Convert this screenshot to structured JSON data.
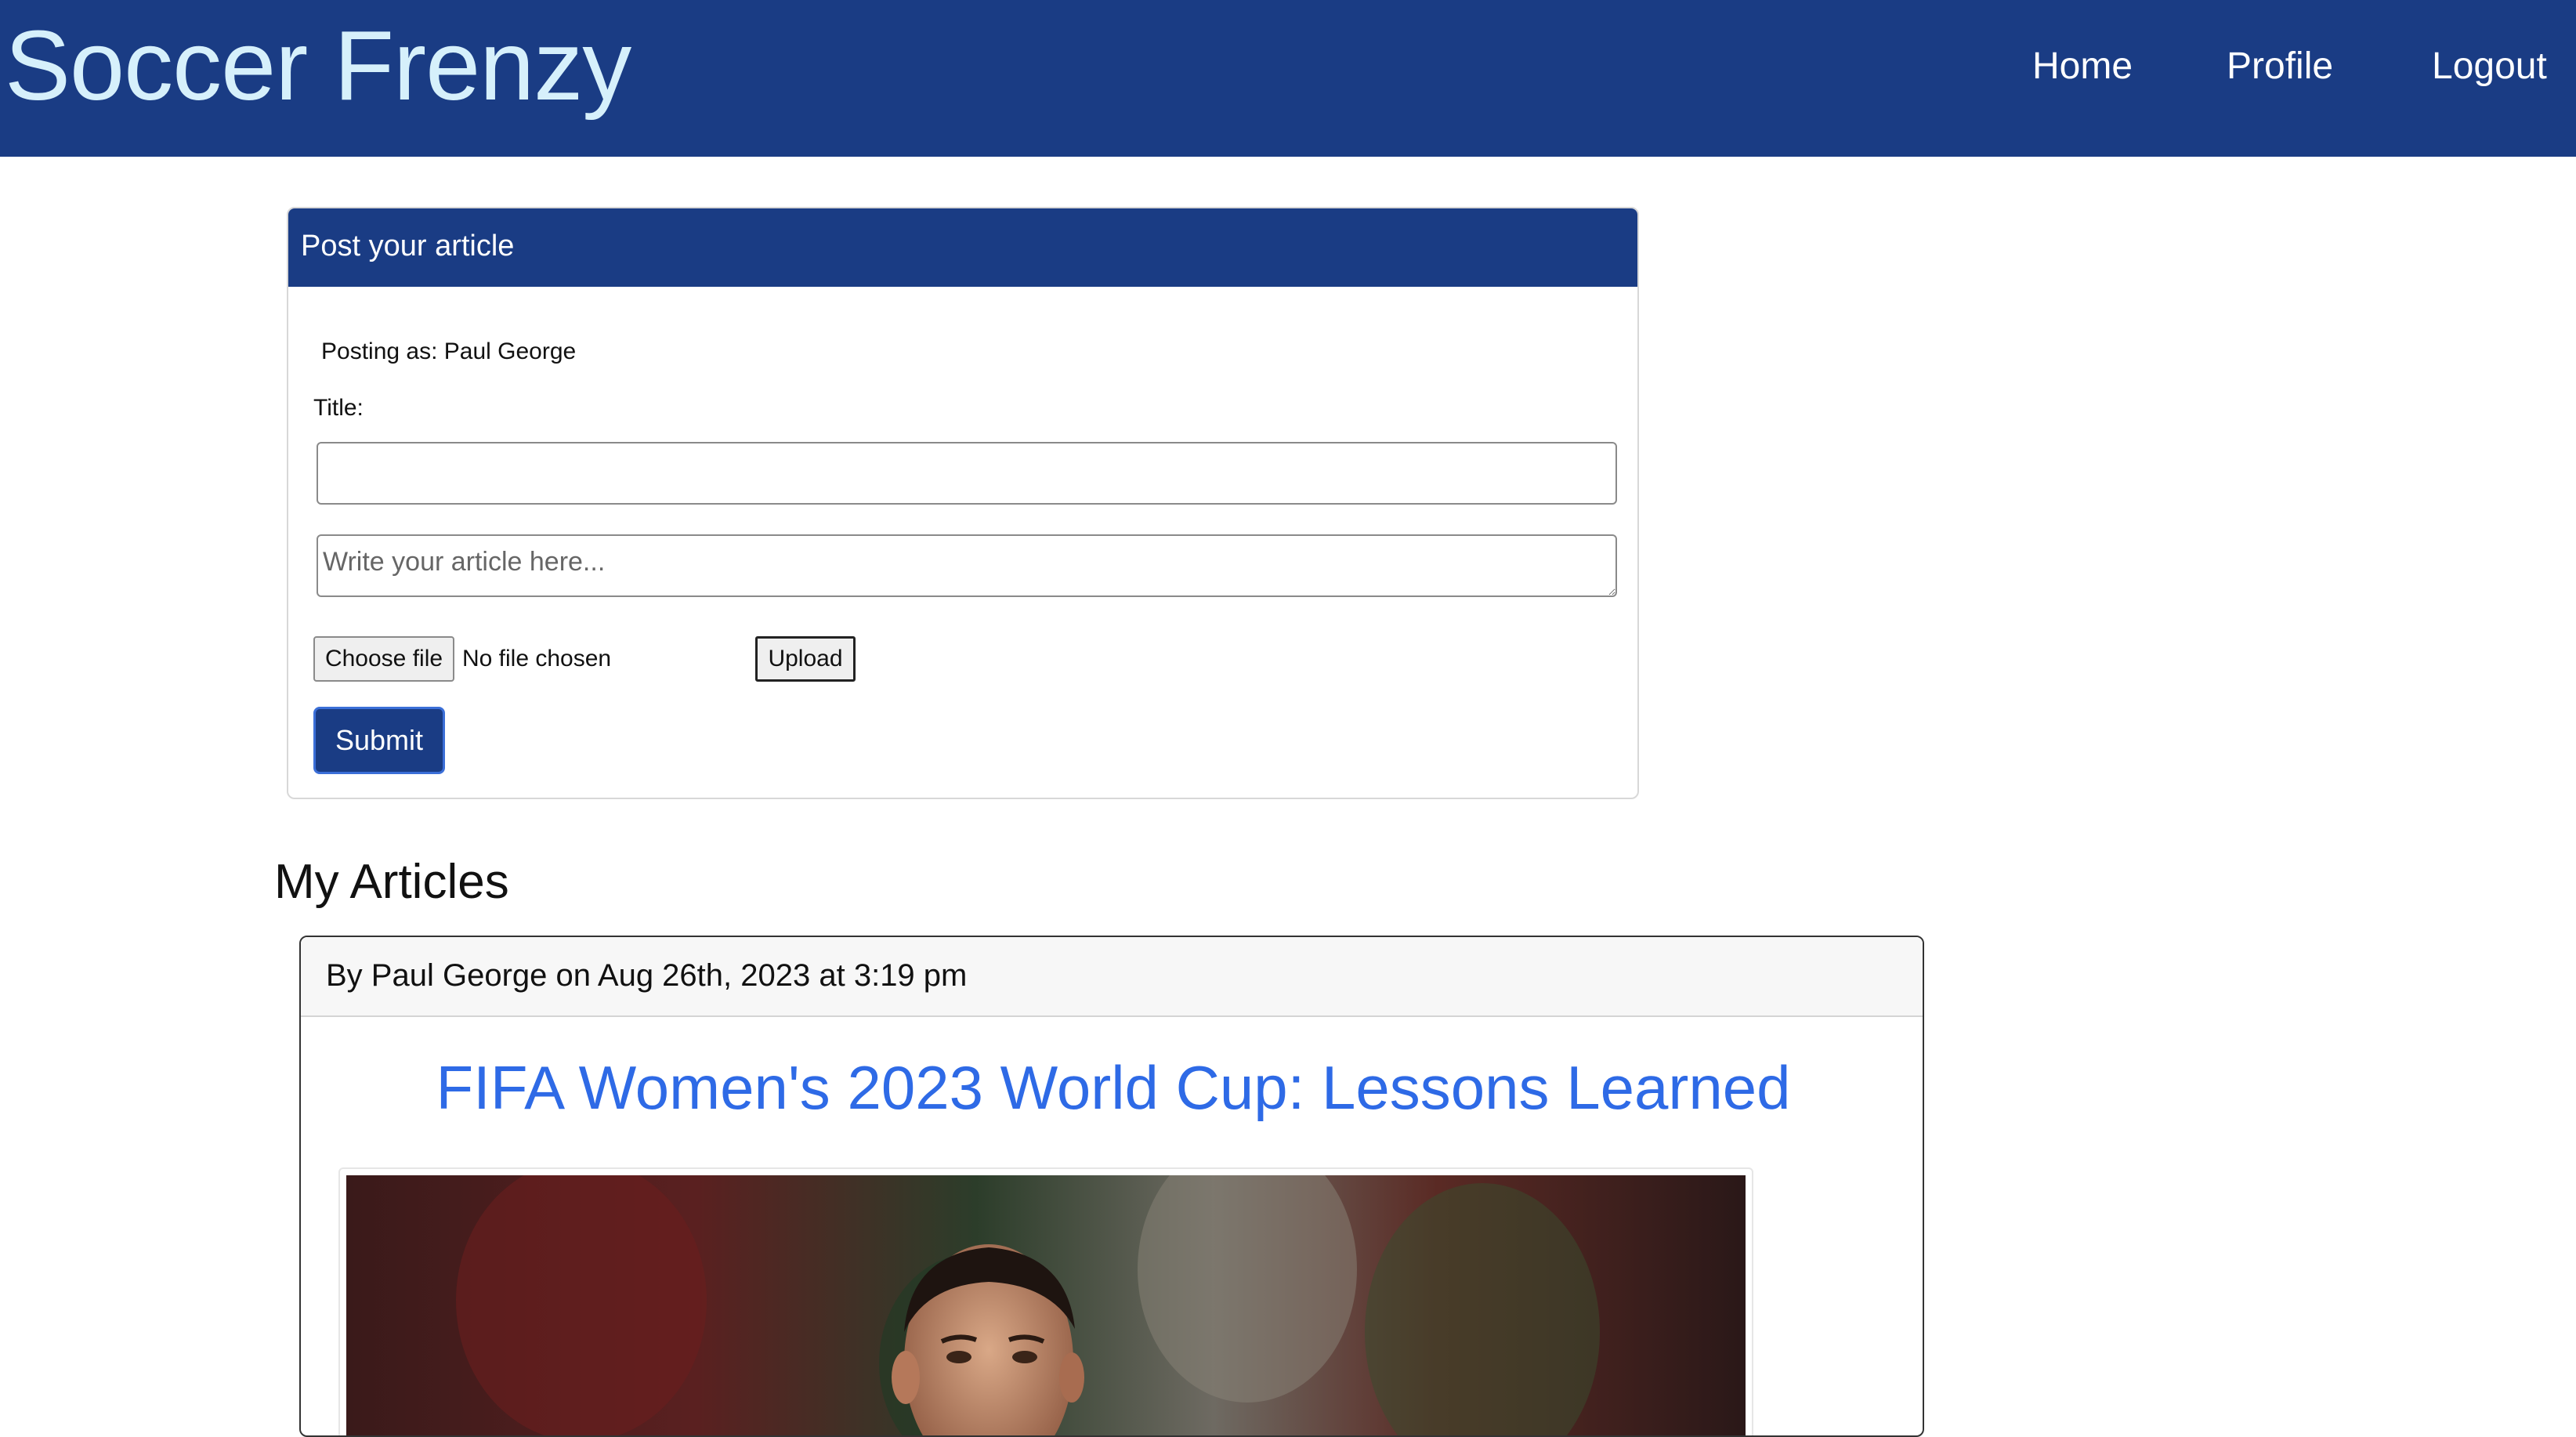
{
  "header": {
    "brand": "Soccer Frenzy",
    "nav": [
      "Home",
      "Profile",
      "Logout"
    ]
  },
  "post_form": {
    "card_title": "Post your article",
    "posting_as": "Posting as: Paul George",
    "title_label": "Title:",
    "title_value": "",
    "article_placeholder": "Write your article here...",
    "choose_file_label": "Choose file",
    "file_status": "No file chosen",
    "upload_label": "Upload",
    "submit_label": "Submit"
  },
  "articles_section": {
    "heading": "My Articles",
    "articles": [
      {
        "byline": "By Paul George on Aug 26th, 2023 at 3:19 pm",
        "title": "FIFA Women's 2023 World Cup: Lessons Learned"
      }
    ]
  },
  "colors": {
    "nav_bg": "#1a3c84",
    "brand_text": "#d6f0fb",
    "link_blue": "#2e6ae6"
  }
}
